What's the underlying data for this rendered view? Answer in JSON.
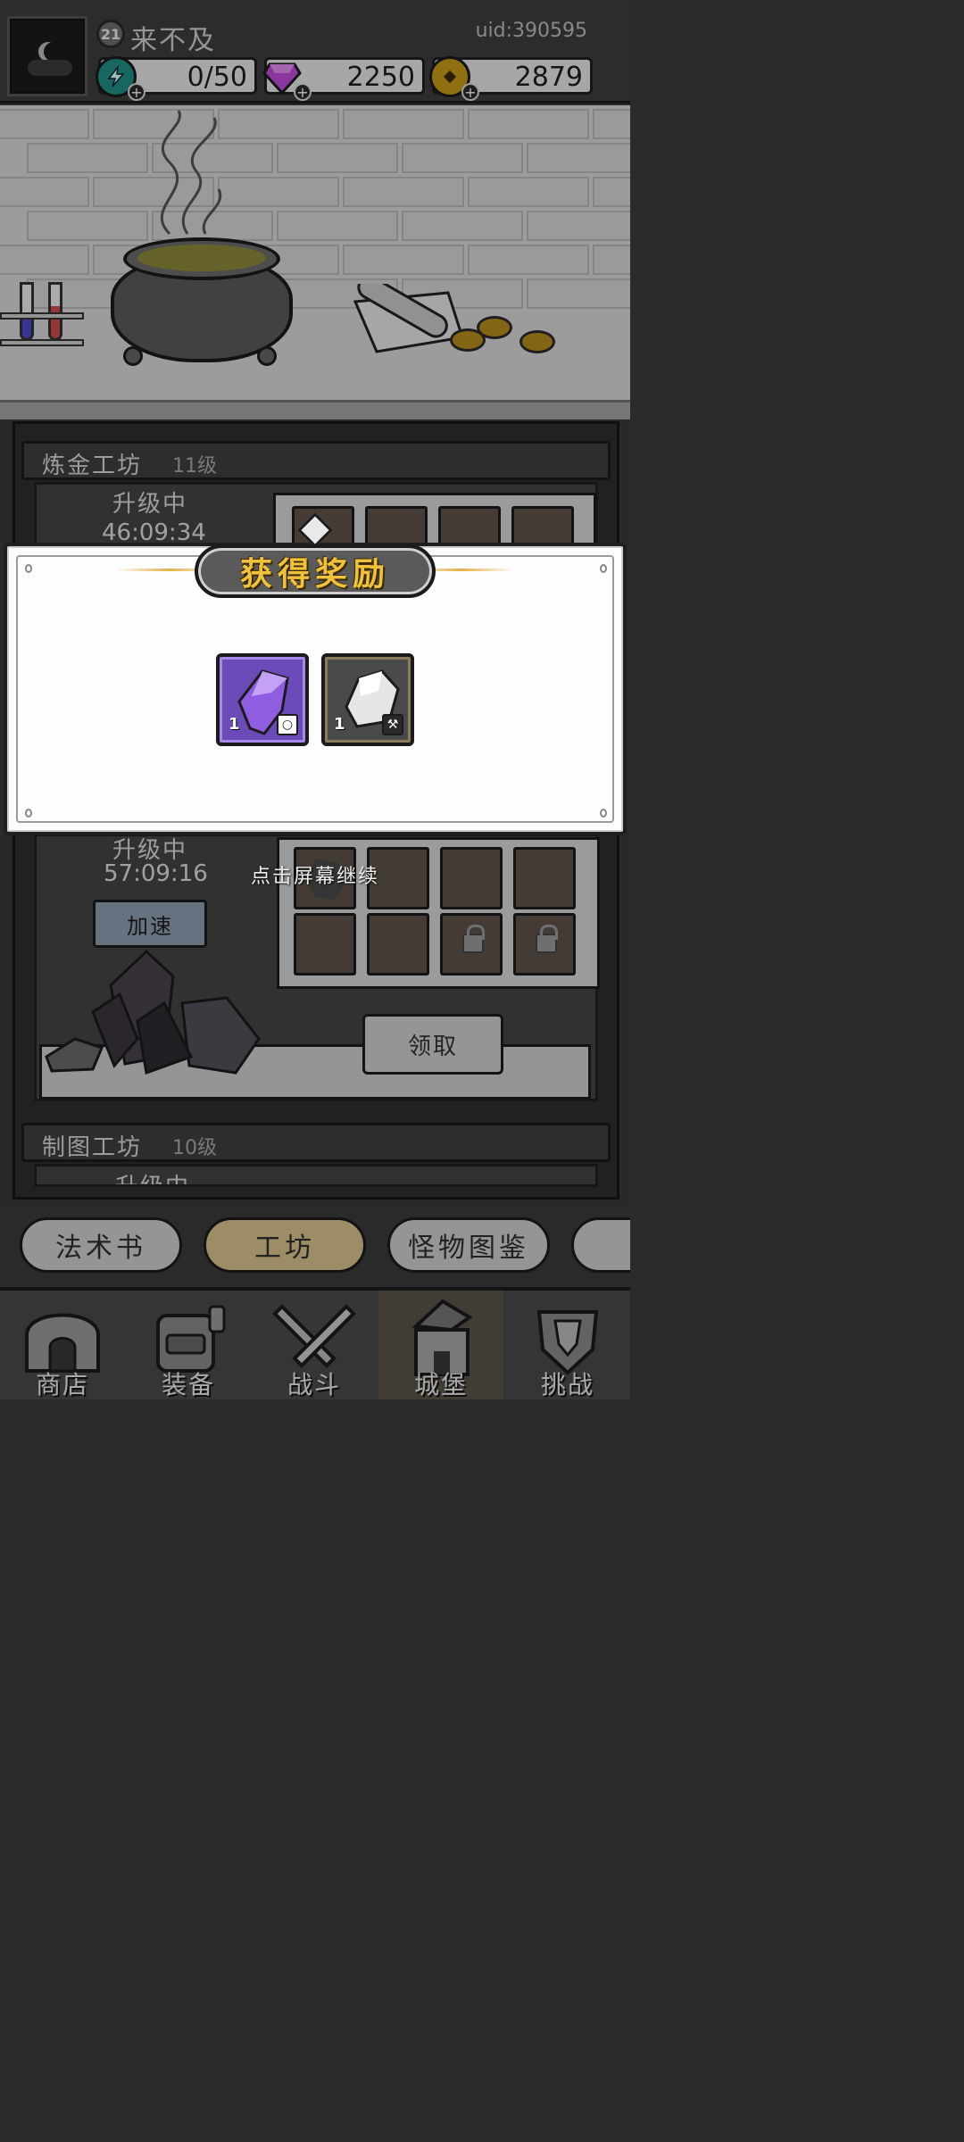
{
  "player": {
    "level": "21",
    "name": "来不及",
    "uid": "uid:390595"
  },
  "resources": [
    {
      "icon": "energy-lightning-icon",
      "value": "0/50",
      "color": "#1f8f85"
    },
    {
      "icon": "purple-gem-icon",
      "value": "2250",
      "color": "#b73ad0"
    },
    {
      "icon": "gold-coin-icon",
      "value": "2879",
      "color": "#c89a1a"
    }
  ],
  "workshops": [
    {
      "name": "炼金工坊",
      "level": "11级",
      "status": "升级中",
      "timer": "46:09:34"
    },
    {
      "name": "",
      "level": "",
      "status": "升级中",
      "timer": "57:09:16",
      "speed_label": "加速",
      "claim_label": "领取"
    },
    {
      "name": "制图工坊",
      "level": "10级",
      "status": "升级中"
    }
  ],
  "popup": {
    "title": "获得奖励",
    "rewards": [
      {
        "icon": "purple-crystal-icon",
        "count": "1",
        "tag_icon": "accessory-tag-icon",
        "color": "#6a4bb8"
      },
      {
        "icon": "white-ore-icon",
        "count": "1",
        "tag_icon": "hammer-tag-icon",
        "color": "#4a4a4a"
      }
    ],
    "continue_hint": "点击屏幕继续"
  },
  "tabs": [
    "法术书",
    "工坊",
    "怪物图鉴"
  ],
  "active_tab": "工坊",
  "nav": [
    {
      "label": "商店",
      "icon": "shop-hut-icon"
    },
    {
      "label": "装备",
      "icon": "backpack-icon"
    },
    {
      "label": "战斗",
      "icon": "crossed-swords-icon"
    },
    {
      "label": "城堡",
      "icon": "wizard-castle-icon"
    },
    {
      "label": "挑战",
      "icon": "shield-crest-icon"
    }
  ],
  "active_nav": "城堡"
}
